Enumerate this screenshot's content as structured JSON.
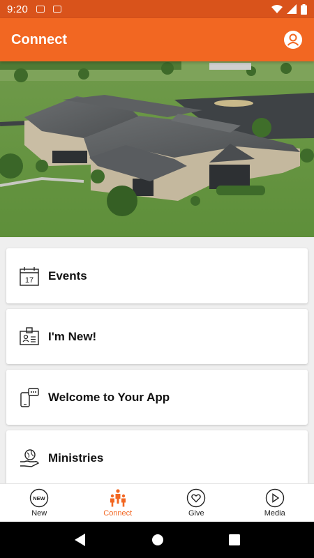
{
  "status_bar": {
    "time": "9:20"
  },
  "app_bar": {
    "title": "Connect"
  },
  "menu": [
    {
      "label": "Events",
      "icon": "calendar-icon"
    },
    {
      "label": "I'm New!",
      "icon": "id-badge-icon"
    },
    {
      "label": "Welcome to Your App",
      "icon": "phone-chat-icon"
    },
    {
      "label": "Ministries",
      "icon": "hand-globe-icon"
    }
  ],
  "calendar_day": "17",
  "bottom_nav": [
    {
      "label": "New",
      "icon": "new-badge-icon"
    },
    {
      "label": "Connect",
      "icon": "people-icon",
      "active": true
    },
    {
      "label": "Give",
      "icon": "heart-icon"
    },
    {
      "label": "Media",
      "icon": "play-icon"
    }
  ],
  "colors": {
    "accent": "#f26722",
    "status": "#d9531b"
  }
}
